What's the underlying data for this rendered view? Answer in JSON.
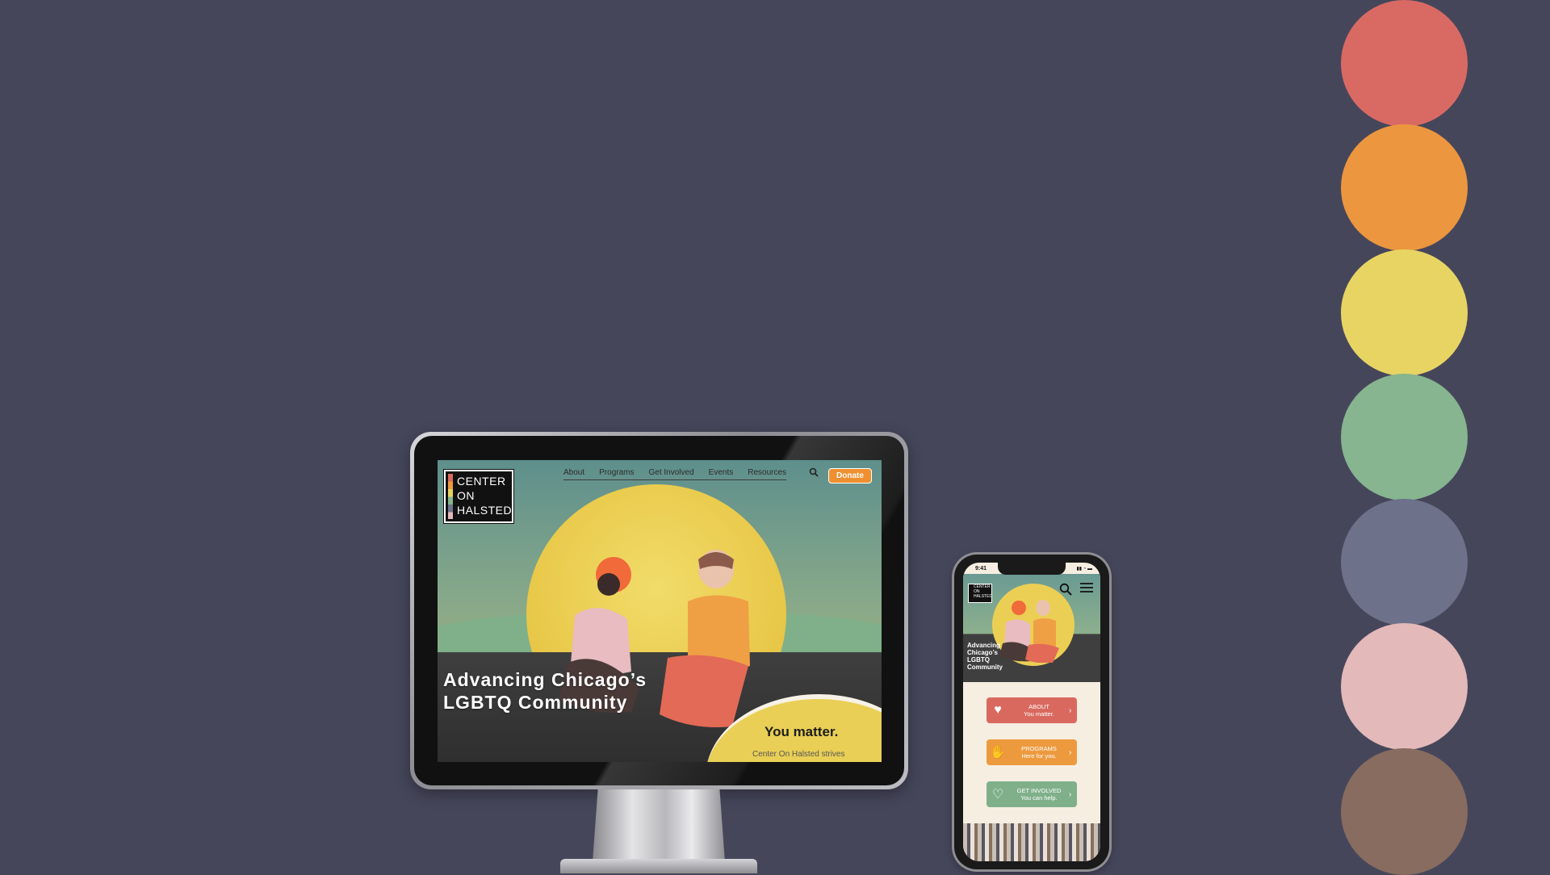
{
  "desktop": {
    "nav": [
      "About",
      "Programs",
      "Get Involved",
      "Events",
      "Resources"
    ],
    "donate_label": "Donate",
    "logo_lines": [
      "CENTER",
      "ON",
      "HALSTED"
    ],
    "hero_title": "Advancing Chicago’s LGBTQ Community",
    "matter_title": "You matter.",
    "matter_sub": "Center On Halsted strives"
  },
  "phone": {
    "time": "9:41",
    "logo_lines": [
      "CENTER",
      "ON",
      "HALSTED"
    ],
    "hero_title": "Advancing Chicago’s LGBTQ Community",
    "tiles": [
      {
        "title": "ABOUT",
        "sub": "You matter."
      },
      {
        "title": "PROGRAMS",
        "sub": "Here for you."
      },
      {
        "title": "GET INVOLVED",
        "sub": "You can help."
      }
    ]
  },
  "palette": [
    "#d96a63",
    "#ec963f",
    "#e8d463",
    "#86b58f",
    "#6d728a",
    "#e3b9b9",
    "#876c5f"
  ],
  "icons": {
    "search": "search-icon",
    "menu": "menu-icon",
    "heart": "heart-icon",
    "hands": "hands-icon",
    "handshake": "handshake-icon",
    "chevron": "chevron-right-icon"
  }
}
